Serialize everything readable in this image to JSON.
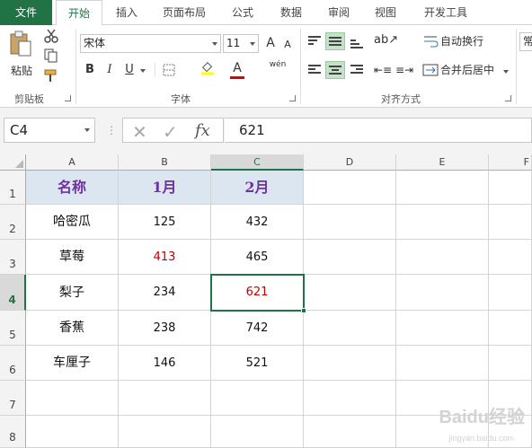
{
  "ribbon": {
    "tabs": [
      "文件",
      "开始",
      "插入",
      "页面布局",
      "公式",
      "数据",
      "审阅",
      "视图",
      "开发工具"
    ],
    "clipboard": {
      "paste_label": "粘贴",
      "group_label": "剪贴板"
    },
    "font": {
      "font_name": "宋体",
      "font_size": "11",
      "group_label": "字体",
      "bold": "B",
      "italic": "I",
      "underline": "U",
      "grow": "A",
      "shrink": "A",
      "font_color": "A",
      "phonetic": "wén"
    },
    "alignment": {
      "wrap_text": "自动换行",
      "merge_center": "合并后居中",
      "group_label": "对齐方式"
    },
    "number_format_partial": "常",
    "accent": "#217346"
  },
  "formula_bar": {
    "name_box": "C4",
    "formula": "621",
    "fx": "fx"
  },
  "grid": {
    "columns": [
      "A",
      "B",
      "C",
      "D",
      "E",
      "F"
    ],
    "rows": [
      "1",
      "2",
      "3",
      "4",
      "5",
      "6",
      "7",
      "8"
    ],
    "header_row": [
      "名称",
      "1月",
      "2月"
    ],
    "data": [
      {
        "name": "哈密瓜",
        "m1": "125",
        "m2": "432",
        "m1_red": false,
        "m2_red": false
      },
      {
        "name": "草莓",
        "m1": "413",
        "m2": "465",
        "m1_red": true,
        "m2_red": false
      },
      {
        "name": "梨子",
        "m1": "234",
        "m2": "621",
        "m1_red": false,
        "m2_red": true
      },
      {
        "name": "香蕉",
        "m1": "238",
        "m2": "742",
        "m1_red": false,
        "m2_red": false
      },
      {
        "name": "车厘子",
        "m1": "146",
        "m2": "521",
        "m1_red": false,
        "m2_red": false
      }
    ],
    "selected_cell": "C4",
    "header_fill": "#dce6f1",
    "header_text_color": "#7030a0",
    "highlight_color": "#c00000"
  },
  "watermark": {
    "text": "Baidu经验",
    "sub": "jingyan.baidu.com"
  }
}
